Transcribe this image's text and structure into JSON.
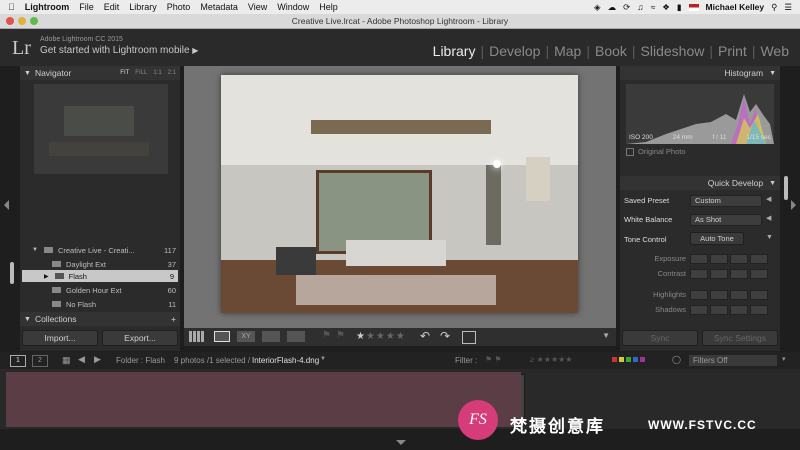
{
  "menubar": {
    "apple": "",
    "app": "Lightroom",
    "items": [
      "File",
      "Edit",
      "Library",
      "Photo",
      "Metadata",
      "View",
      "Window",
      "Help"
    ],
    "user": "Michael Kelley"
  },
  "window": {
    "title": "Creative Live.lrcat - Adobe Photoshop Lightroom - Library"
  },
  "identity": {
    "logo": "Lr",
    "version": "Adobe Lightroom CC 2015",
    "subtitle": "Get started with Lightroom mobile"
  },
  "modules": [
    "Library",
    "Develop",
    "Map",
    "Book",
    "Slideshow",
    "Print",
    "Web"
  ],
  "active_module": "Library",
  "navigator": {
    "title": "Navigator",
    "zoom_options": [
      "FIT",
      "FILL",
      "1:1",
      "2:1"
    ]
  },
  "folders": [
    {
      "name": "Creative Live - Creati...",
      "count": "117"
    },
    {
      "name": "Daylight Ext",
      "count": "37"
    },
    {
      "name": "Flash",
      "count": "9"
    },
    {
      "name": "Golden Hour Ext",
      "count": "60"
    },
    {
      "name": "No Flash",
      "count": "11"
    }
  ],
  "collections": {
    "title": "Collections",
    "add": "+"
  },
  "left_buttons": {
    "import": "Import...",
    "export": "Export..."
  },
  "histogram": {
    "title": "Histogram",
    "iso": "ISO 200",
    "focal": "24 mm",
    "aperture": "f / 11",
    "shutter": "1/15 sec",
    "original_photo": "Original Photo"
  },
  "quick_develop": {
    "title": "Quick Develop",
    "saved_preset_label": "Saved Preset",
    "saved_preset_value": "Custom",
    "white_balance_label": "White Balance",
    "white_balance_value": "As Shot",
    "tone_control_label": "Tone Control",
    "auto_tone": "Auto Tone",
    "sliders": [
      "Exposure",
      "Contrast",
      "Highlights",
      "Shadows"
    ]
  },
  "right_buttons": {
    "sync": "Sync",
    "sync_settings": "Sync Settings"
  },
  "filmstrip": {
    "screen1": "1",
    "screen2": "2",
    "folder_label": "Folder : Flash",
    "selection_info": "9 photos /1 selected /",
    "filename": "InteriorFlash-4.dng",
    "filter_label": "Filter :",
    "filter_value": "Filters Off",
    "thumb_count": 9,
    "selected_index": 2
  },
  "watermark": {
    "logo": "FS",
    "chinese": "梵摄创意库",
    "url": "WWW.FSTVC.CC"
  },
  "colors": {
    "accent_red": "#d63b7a",
    "panel": "#2b2b2b",
    "center_bg": "#737373"
  }
}
